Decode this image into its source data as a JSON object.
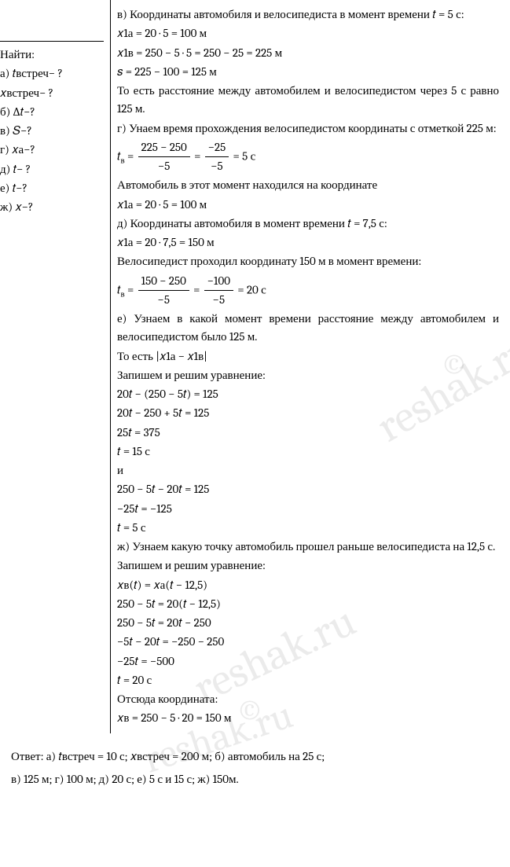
{
  "left": {
    "find": "Найти:",
    "a": "а) 𝑡встреч− ?",
    "a2": "𝑥встреч− ?",
    "b": "б) ∆𝑡−?",
    "v": "в) 𝑆−?",
    "g": "г) 𝑥а−?",
    "d": "д) 𝑡− ?",
    "e": "е) 𝑡−?",
    "zh": "ж) 𝑥−?"
  },
  "r": {
    "v_intro": "в) Координаты автомобиля и велосипедиста в момент времени 𝑡 = 5 с:",
    "v_x1a": "𝑥1а = 20 · 5 = 100 м",
    "v_x1v": "𝑥1в = 250 − 5 · 5 = 250 − 25 = 225 м",
    "v_s": "𝑠 = 225 − 100 = 125 м",
    "v_concl": "То есть расстояние между автомобилем и велосипедистом через 5 с равно 125 м.",
    "g_intro": "г) Унаем время прохождения велосипедистом координаты с отметкой 225 м:",
    "g_tv_num": "225 − 250",
    "g_tv_den": "−5",
    "g_tv_num2": "−25",
    "g_tv_rhs": "= 5 с",
    "g_auto": "Автомобиль в этот момент находился на координате",
    "g_x1a": "𝑥1а = 20 · 5 = 100 м",
    "d_intro": "д) Координаты автомобиля в момент времени 𝑡 = 7,5 с:",
    "d_x1a": "𝑥1а = 20 · 7,5 = 150 м",
    "d_bike": "Велосипедист проходил координату 150 м в момент времени:",
    "d_tv_num": "150 − 250",
    "d_tv_num2": "−100",
    "d_tv_rhs": "= 20 с",
    "e_intro": "е) Узнаем в какой момент времени расстояние между автомобилем и велосипедистом было 125 м.",
    "e_abs": "То есть |𝑥1а − 𝑥1в|",
    "e_write": "Запишем и решим уравнение:",
    "e_eq1": "20𝑡 − (250 − 5𝑡) = 125",
    "e_eq2": "20𝑡 − 250 + 5𝑡 = 125",
    "e_eq3": "25𝑡 = 375",
    "e_eq4": "𝑡 = 15 с",
    "e_and": "и",
    "e_eq5": "250 − 5𝑡 − 20𝑡 = 125",
    "e_eq6": "−25𝑡 = −125",
    "e_eq7": "𝑡 = 5 с",
    "zh_intro": "ж) Узнаем какую точку автомобиль прошел раньше велосипедиста на 12,5 с.",
    "zh_write": "Запишем и решим уравнение:",
    "zh_eq1": "𝑥в(𝑡) = 𝑥а(𝑡 − 12,5)",
    "zh_eq2": "250 − 5𝑡 = 20(𝑡 − 12,5)",
    "zh_eq3": "250 − 5𝑡 = 20𝑡 − 250",
    "zh_eq4": "−5𝑡 − 20𝑡 = −250 − 250",
    "zh_eq5": "−25𝑡 = −500",
    "zh_eq6": "𝑡 = 20 с",
    "zh_from": "Отсюда координата:",
    "zh_xv": "𝑥в = 250 − 5 · 20 = 150 м"
  },
  "ans": {
    "l1": "Ответ: а) 𝑡встреч = 10 с;   𝑥встреч = 200 м; б) автомобиль на 25 с;",
    "l2": "в) 125 м; г) 100 м; д) 20 с; е) 5 с и 15 с; ж) 150м."
  },
  "wm": "reshak.ru"
}
